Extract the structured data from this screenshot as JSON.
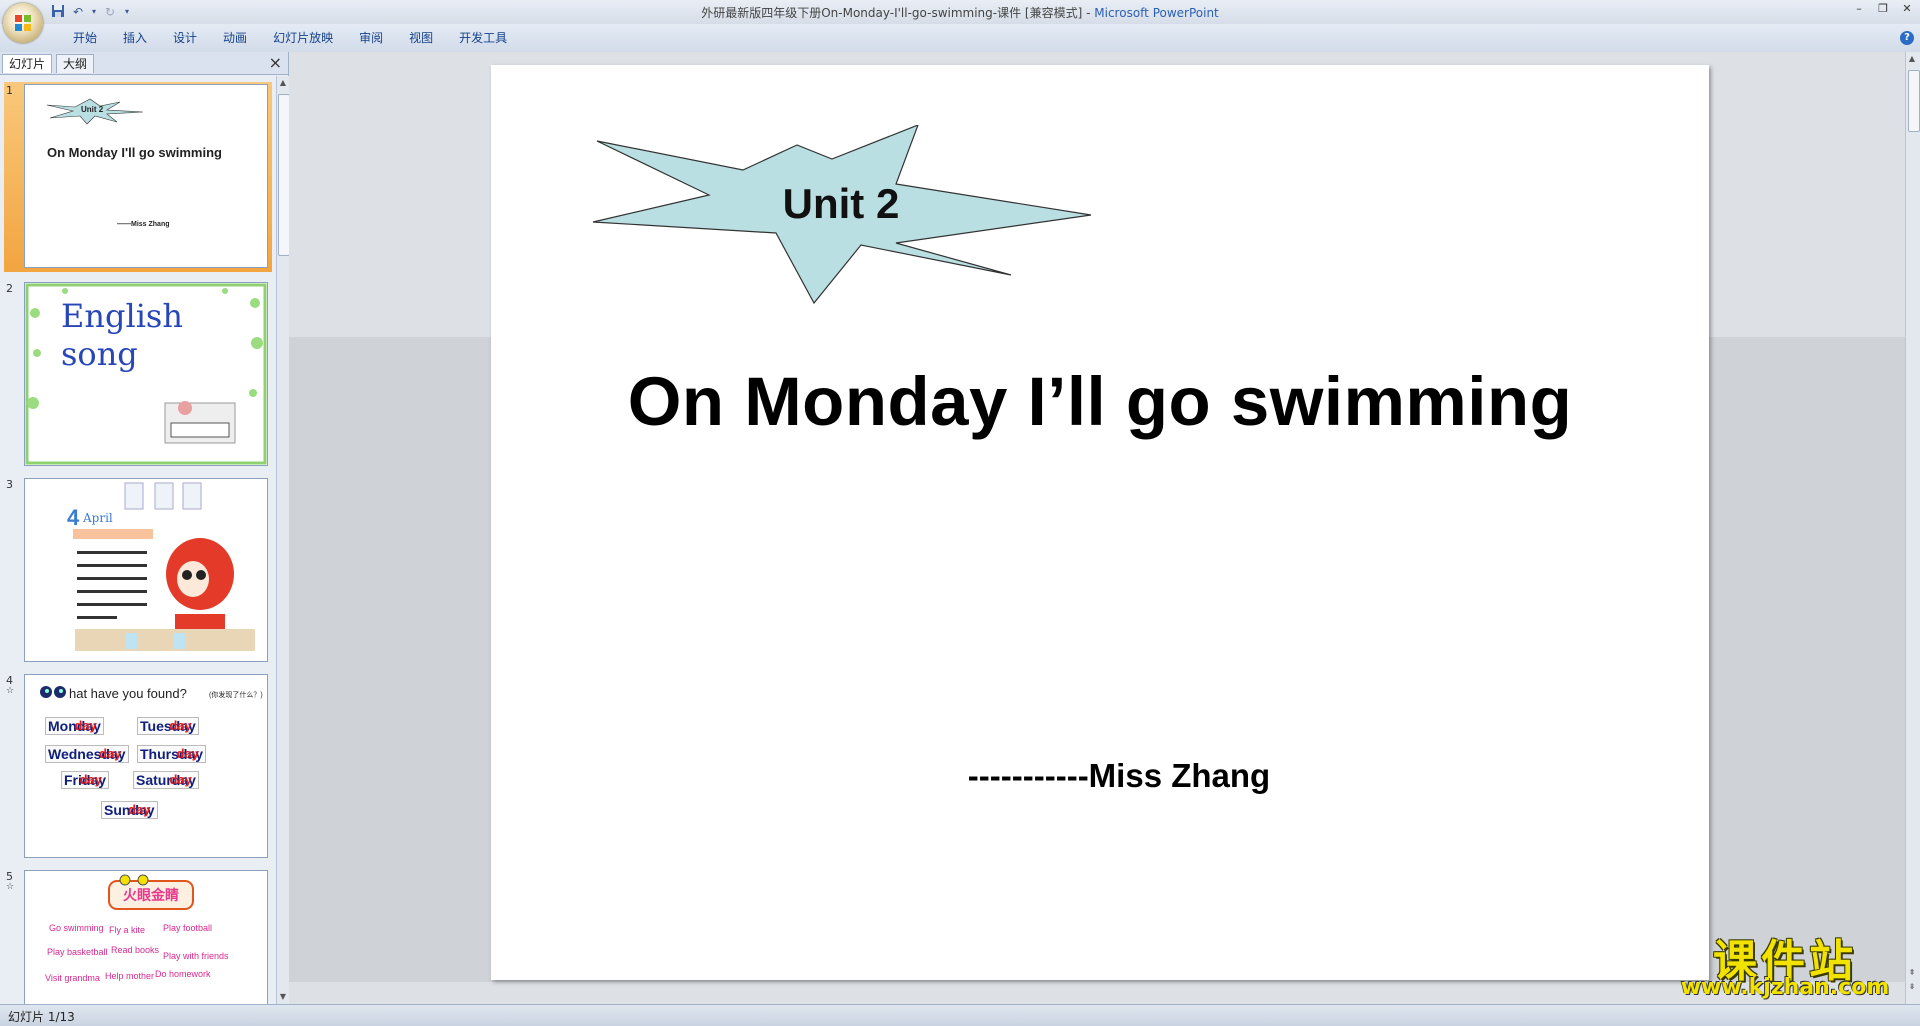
{
  "window": {
    "title": "外研最新版四年级下册On-Monday-I'll-go-swimming-课件 [兼容模式]",
    "title_sep": " - ",
    "app_name": "Microsoft PowerPoint"
  },
  "ribbon": {
    "tabs": [
      "开始",
      "插入",
      "设计",
      "动画",
      "幻灯片放映",
      "审阅",
      "视图",
      "开发工具"
    ]
  },
  "left_pane": {
    "tab_slides": "幻灯片",
    "tab_outline": "大纲",
    "thumbnails": [
      {
        "num": "1",
        "unit": "Unit 2",
        "title": "On Monday I'll go swimming",
        "author": "——Miss Zhang"
      },
      {
        "num": "2",
        "heading": "English song"
      },
      {
        "num": "3",
        "month": "April",
        "month_num": "4"
      },
      {
        "num": "4",
        "heading": "hat have you found?",
        "sub": "(你发现了什么？)",
        "days": [
          "Monday",
          "Tuesday",
          "Wednesday",
          "Thursday",
          "Friday",
          "Saturday",
          "Sunday"
        ],
        "overlay": "day"
      },
      {
        "num": "5",
        "badge": "火眼金睛",
        "phrases": [
          "Go swimming",
          "Fly a kite",
          "Play football",
          "Play basketball",
          "Read books",
          "Play with friends",
          "Visit grandma",
          "Help mother",
          "Do homework"
        ]
      }
    ]
  },
  "slide": {
    "unit": "Unit 2",
    "title": "On Monday I’ll go swimming",
    "author": "-----------Miss Zhang"
  },
  "status": {
    "slide_counter": "幻灯片 1/13"
  },
  "watermark": {
    "chinese": "课件站",
    "url": "www.kjzhan.com"
  },
  "colors": {
    "burst_fill": "#b9dfe2",
    "thumb_selected": "#f2a540",
    "ribbon_text": "#15428b",
    "watermark": "#f2e200"
  }
}
